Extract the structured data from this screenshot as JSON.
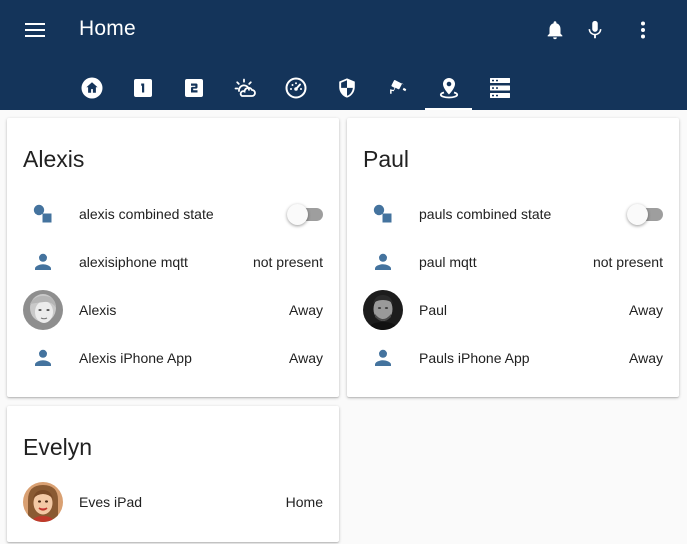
{
  "header": {
    "title": "Home",
    "icons": [
      "menu-icon",
      "bell-icon",
      "microphone-icon",
      "more-vertical-icon"
    ]
  },
  "tabs": [
    {
      "icon": "home-icon",
      "active": false
    },
    {
      "icon": "numeric-1-box-icon",
      "active": false
    },
    {
      "icon": "numeric-2-box-icon",
      "active": false
    },
    {
      "icon": "weather-sunset-icon",
      "active": false
    },
    {
      "icon": "gauge-icon",
      "active": false
    },
    {
      "icon": "security-shield-icon",
      "active": false
    },
    {
      "icon": "cctv-camera-icon",
      "active": false
    },
    {
      "icon": "map-marker-icon",
      "active": true
    },
    {
      "icon": "server-icon",
      "active": false
    }
  ],
  "cards": [
    {
      "title": "Alexis",
      "rows": [
        {
          "icon": "group-icon",
          "label": "alexis combined state",
          "toggle": false
        },
        {
          "icon": "account-icon",
          "label": "alexisiphone mqtt",
          "value": "not present"
        },
        {
          "icon": "avatar",
          "label": "Alexis",
          "value": "Away"
        },
        {
          "icon": "account-icon",
          "label": "Alexis iPhone App",
          "value": "Away"
        }
      ]
    },
    {
      "title": "Paul",
      "rows": [
        {
          "icon": "group-icon",
          "label": "pauls combined state",
          "toggle": false
        },
        {
          "icon": "account-icon",
          "label": "paul mqtt",
          "value": "not present"
        },
        {
          "icon": "avatar",
          "label": "Paul",
          "value": "Away"
        },
        {
          "icon": "account-icon",
          "label": "Pauls iPhone App",
          "value": "Away"
        }
      ]
    },
    {
      "title": "Evelyn",
      "rows": [
        {
          "icon": "avatar",
          "label": "Eves iPad",
          "value": "Home"
        }
      ]
    }
  ],
  "colors": {
    "header_bg": "#14345a",
    "state_icon": "#44739e",
    "page_bg": "#fafafa",
    "toggle_track_off": "#9e9e9e"
  }
}
